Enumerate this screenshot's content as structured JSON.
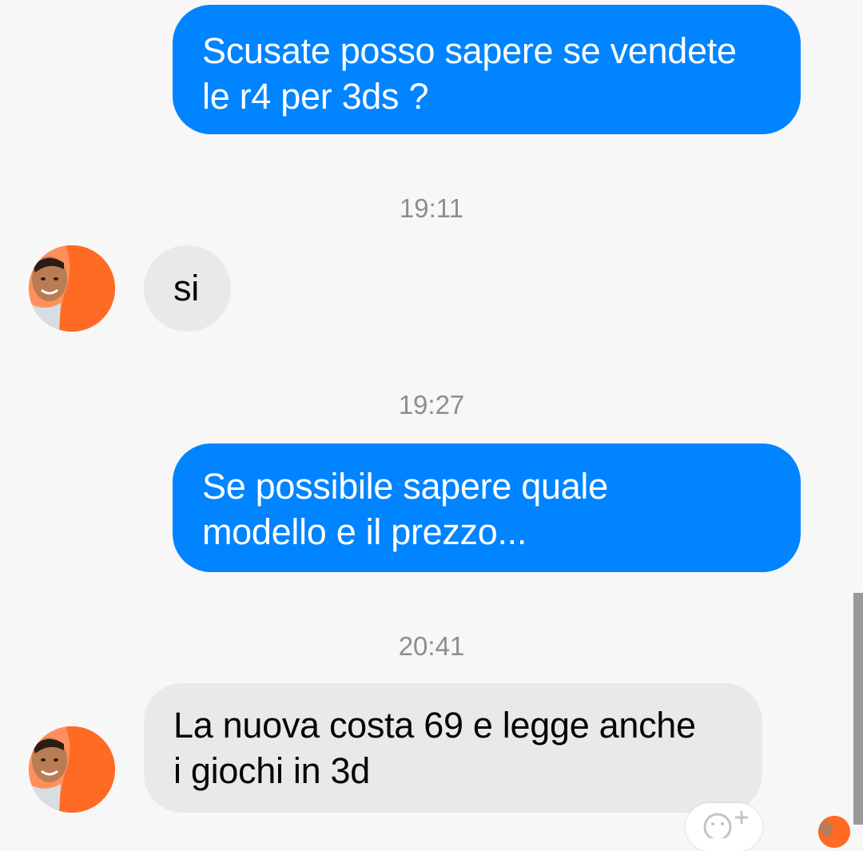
{
  "conversation": {
    "messages": [
      {
        "direction": "outgoing",
        "lines": [
          "Scusate posso sapere se vendete",
          "le r4 per 3ds ?"
        ]
      },
      {
        "timestamp": "19:11"
      },
      {
        "direction": "incoming",
        "lines": [
          "si"
        ]
      },
      {
        "timestamp": "19:27"
      },
      {
        "direction": "outgoing",
        "lines": [
          "Se possibile sapere quale",
          "modello e il prezzo..."
        ]
      },
      {
        "timestamp": "20:41"
      },
      {
        "direction": "incoming",
        "lines": [
          "La nuova costa 69 e legge anche",
          "i giochi in 3d"
        ]
      }
    ]
  },
  "icons": {
    "avatar": "contact-avatar",
    "reaction": "add-reaction-icon",
    "read_receipt": "read-receipt-avatar"
  },
  "colors": {
    "outgoing_bubble": "#0084ff",
    "incoming_bubble": "#e9e9eb",
    "background": "#f7f7f7",
    "timestamp": "#8e8e8e",
    "avatar_bg": "#ff6a25"
  }
}
